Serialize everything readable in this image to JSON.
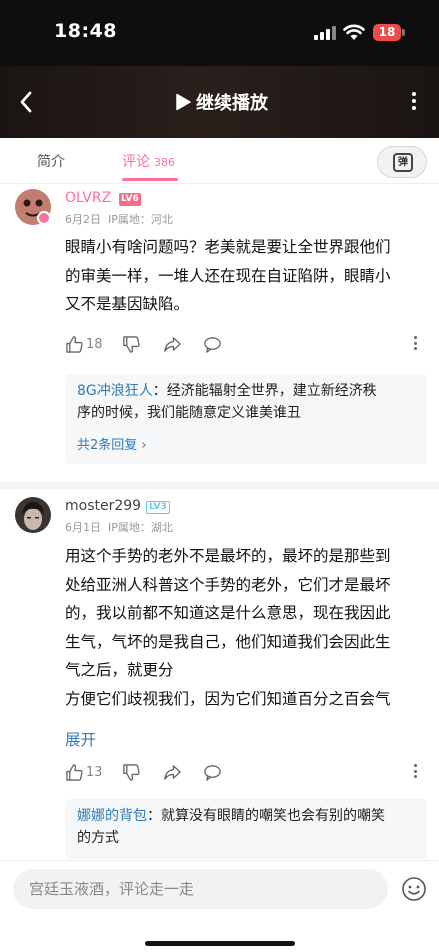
{
  "status_bar": {
    "time": "18:48",
    "battery": "18"
  },
  "header": {
    "play_label": "继续播放"
  },
  "tabs": {
    "intro": "简介",
    "comments": "评论",
    "comment_count": "386",
    "danmaku_label": "弹"
  },
  "comments": [
    {
      "username": "OLVRZ",
      "level": "LV6",
      "date": "6月2日",
      "ip": "IP属地：河北",
      "lines": [
        "眼睛小有啥问题吗？老美就是要让全世界跟他们",
        "的审美一样，一堆人还在现在自证陷阱，眼睛小",
        "又不是基因缺陷。"
      ],
      "likes": "18",
      "reply_user": "8G冲浪狂人",
      "reply_lines": [
        "：经济能辐射全世界，建立新经济秩",
        "序的时候，我们能随意定义谁美谁丑"
      ],
      "reply_more": "共2条回复 ›"
    },
    {
      "username": "moster299",
      "level": "LV3",
      "date": "6月1日",
      "ip": "IP属地：湖北",
      "lines": [
        "用这个手势的老外不是最坏的，最坏的是那些到",
        "处给亚洲人科普这个手势的老外，它们才是最坏",
        "的，我以前都不知道这是什么意思，现在我因此",
        "生气，气坏的是我自己，他们知道我们会因此生",
        "气之后，就更分",
        "方便它们歧视我们，因为它们知道百分之百会气"
      ],
      "expand": "展开",
      "likes": "13",
      "reply_user": "娜娜的背包",
      "reply_lines": [
        "：就算没有眼睛的嘲笑也会有别的嘲笑",
        "的方式"
      ]
    }
  ],
  "input": {
    "placeholder": "宫廷玉液酒，评论走一走"
  },
  "colors": {
    "accent_pink": "#fb7299",
    "link_blue": "#2f7bb9",
    "lv6": "#f76b8a",
    "lv3": "#6cc8e8"
  }
}
